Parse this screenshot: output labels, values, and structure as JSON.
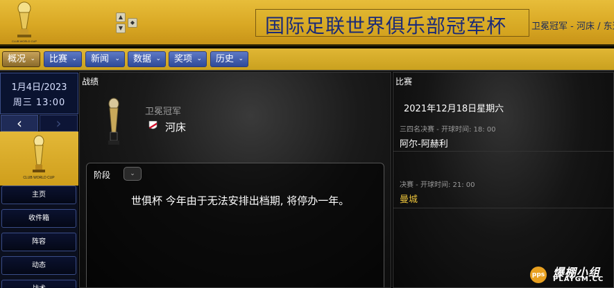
{
  "header": {
    "title": "国际足联世界俱乐部冠军杯",
    "subtitle": "卫冕冠军 - 河床 / 东道",
    "logo_text": "CLUB WORLD CUP",
    "arrow_up": "▲",
    "arrow_down": "▼",
    "arrow_side": "◆"
  },
  "menu": [
    {
      "label": "概况"
    },
    {
      "label": "比赛"
    },
    {
      "label": "新闻"
    },
    {
      "label": "数据"
    },
    {
      "label": "奖项"
    },
    {
      "label": "历史"
    }
  ],
  "menu_chevron": "⌄",
  "sidebar": {
    "date": "1月4日/2023",
    "time": "周三 13:00",
    "prev": "‹",
    "next": "›",
    "buttons": [
      {
        "label": "主页"
      },
      {
        "label": "收件箱"
      },
      {
        "label": "阵容"
      },
      {
        "label": "动态"
      },
      {
        "label": "战术"
      }
    ]
  },
  "results_panel": {
    "title": "战绩",
    "winner_label": "卫冕冠军",
    "winner_club": "河床",
    "stage_label": "阶段",
    "stage_dropdown": "⌄",
    "stage_message": "世俱杯 今年由于无法安排出档期, 将停办一年。"
  },
  "matches_panel": {
    "title": "比赛",
    "date": "2021年12月18日星期六",
    "matches": [
      {
        "meta": "三四名决赛 - 开球时间: 18: 00",
        "team": "阿尔-阿赫利",
        "team_color": "#ffffff"
      },
      {
        "meta": "决赛 - 开球时间: 21: 00",
        "team": "曼城",
        "team_color": "#e8c03a"
      }
    ]
  },
  "watermark": {
    "logo": "pps",
    "line1": "爆棚小组",
    "line2": "PLAYGM.CC"
  },
  "colors": {
    "gold": "#d9a824",
    "menu_blue": "#3b58a8",
    "title_blue": "#1a2a78",
    "winner_gold": "#e8c03a"
  }
}
